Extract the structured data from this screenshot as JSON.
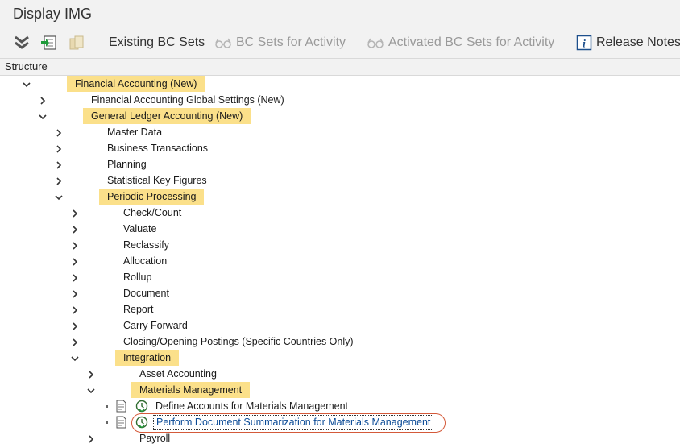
{
  "window": {
    "title": "Display IMG"
  },
  "toolbar": {
    "buttons": [
      {
        "label": "Existing BC Sets",
        "icon": "bc-sets-icon",
        "enabled": true
      },
      {
        "label": "BC Sets for Activity",
        "icon": "glasses-icon",
        "enabled": false
      },
      {
        "label": "Activated BC Sets for Activity",
        "icon": "glasses-icon",
        "enabled": false
      },
      {
        "label": "Release Notes",
        "icon": "info-icon",
        "enabled": true
      }
    ]
  },
  "structure": {
    "header": "Structure",
    "nodes": [
      {
        "label": "Financial Accounting (New)",
        "expanded": true,
        "highlighted": true
      },
      {
        "label": "Financial Accounting Global Settings (New)",
        "expanded": false,
        "highlighted": false
      },
      {
        "label": "General Ledger Accounting (New)",
        "expanded": true,
        "highlighted": true
      },
      {
        "label": "Master Data",
        "expanded": false,
        "highlighted": false
      },
      {
        "label": "Business Transactions",
        "expanded": false,
        "highlighted": false
      },
      {
        "label": "Planning",
        "expanded": false,
        "highlighted": false
      },
      {
        "label": "Statistical Key Figures",
        "expanded": false,
        "highlighted": false
      },
      {
        "label": "Periodic Processing",
        "expanded": true,
        "highlighted": true
      },
      {
        "label": "Check/Count",
        "expanded": false,
        "highlighted": false
      },
      {
        "label": "Valuate",
        "expanded": false,
        "highlighted": false
      },
      {
        "label": "Reclassify",
        "expanded": false,
        "highlighted": false
      },
      {
        "label": "Allocation",
        "expanded": false,
        "highlighted": false
      },
      {
        "label": "Rollup",
        "expanded": false,
        "highlighted": false
      },
      {
        "label": "Document",
        "expanded": false,
        "highlighted": false
      },
      {
        "label": "Report",
        "expanded": false,
        "highlighted": false
      },
      {
        "label": "Carry Forward",
        "expanded": false,
        "highlighted": false
      },
      {
        "label": "Closing/Opening Postings (Specific Countries Only)",
        "expanded": false,
        "highlighted": false
      },
      {
        "label": "Integration",
        "expanded": true,
        "highlighted": true
      },
      {
        "label": "Asset Accounting",
        "expanded": false,
        "highlighted": false
      },
      {
        "label": "Materials Management",
        "expanded": true,
        "highlighted": true
      },
      {
        "label": "Define Accounts for Materials Management",
        "activity": true
      },
      {
        "label": "Perform Document Summarization for Materials Management",
        "activity": true,
        "selected": true
      },
      {
        "label": "Payroll",
        "expanded": false,
        "highlighted": false
      }
    ]
  },
  "colors": {
    "highlight": "#fbe08a",
    "callout": "#d45a3a",
    "link": "#0a4a96"
  }
}
